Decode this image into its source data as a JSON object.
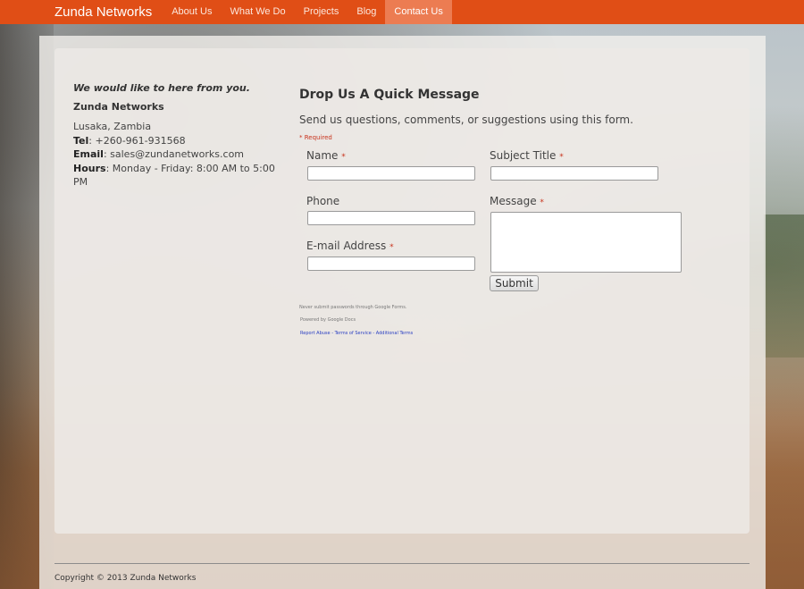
{
  "nav": {
    "brand": "Zunda Networks",
    "items": [
      {
        "label": "About Us",
        "active": false
      },
      {
        "label": "What We Do",
        "active": false
      },
      {
        "label": "Projects",
        "active": false
      },
      {
        "label": "Blog",
        "active": false
      },
      {
        "label": "Contact Us",
        "active": true
      }
    ]
  },
  "contact": {
    "tagline": "We would like to here from you.",
    "company": "Zunda Networks",
    "location": "Lusaka, Zambia",
    "tel_label": "Tel",
    "tel": ": +260-961-931568",
    "email_label": "Email",
    "email": ": sales@zundanetworks.com",
    "hours_label": "Hours",
    "hours": ": Monday - Friday: 8:00 AM to 5:00 PM"
  },
  "form": {
    "title": "Drop Us A Quick Message",
    "description": "Send us questions, comments, or suggestions using this form.",
    "required_note": "* Required",
    "required_star": "*",
    "fields": {
      "name": {
        "label": "Name",
        "value": ""
      },
      "subject": {
        "label": "Subject Title",
        "value": ""
      },
      "phone": {
        "label": "Phone",
        "value": ""
      },
      "message": {
        "label": "Message",
        "value": ""
      },
      "email": {
        "label": "E-mail Address",
        "value": ""
      }
    },
    "submit_label": "Submit",
    "footnote_passwords": "Never submit passwords through Google Forms.",
    "footnote_powered": "Powered by Google Docs",
    "links": {
      "report_abuse": "Report Abuse",
      "terms": "Terms of Service",
      "additional_terms": "Additional Terms",
      "separator": " - "
    }
  },
  "footer": {
    "copyright": "Copyright © 2013 Zunda Networks"
  },
  "colors": {
    "nav_bg": "#e04e16",
    "nav_active": "#ec7c52",
    "required": "#c8331c",
    "link": "#2a3fc2"
  }
}
